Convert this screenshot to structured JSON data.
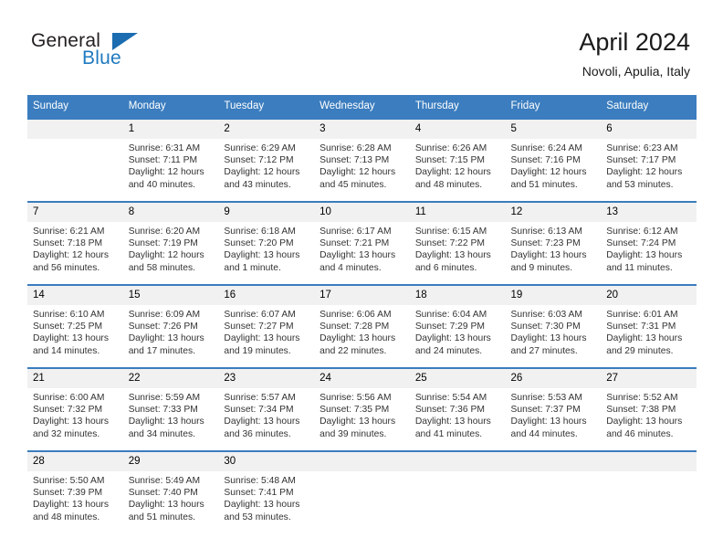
{
  "brand": {
    "name_top": "General",
    "name_bottom": "Blue",
    "accent_color": "#1b6cb0"
  },
  "header": {
    "title": "April 2024",
    "subtitle": "Novoli, Apulia, Italy"
  },
  "theme": {
    "header_blue": "#3b7dbf",
    "daynum_bg": "#f1f1f1"
  },
  "calendar": {
    "weekday_headers": [
      "Sunday",
      "Monday",
      "Tuesday",
      "Wednesday",
      "Thursday",
      "Friday",
      "Saturday"
    ],
    "labels": {
      "sunrise": "Sunrise:",
      "sunset": "Sunset:",
      "daylight": "Daylight:"
    },
    "weeks": [
      [
        {
          "day": "",
          "empty": true,
          "sunrise": "",
          "sunset": "",
          "daylight_line1": "",
          "daylight_line2": ""
        },
        {
          "day": "1",
          "sunrise": "Sunrise: 6:31 AM",
          "sunset": "Sunset: 7:11 PM",
          "daylight_line1": "Daylight: 12 hours",
          "daylight_line2": "and 40 minutes."
        },
        {
          "day": "2",
          "sunrise": "Sunrise: 6:29 AM",
          "sunset": "Sunset: 7:12 PM",
          "daylight_line1": "Daylight: 12 hours",
          "daylight_line2": "and 43 minutes."
        },
        {
          "day": "3",
          "sunrise": "Sunrise: 6:28 AM",
          "sunset": "Sunset: 7:13 PM",
          "daylight_line1": "Daylight: 12 hours",
          "daylight_line2": "and 45 minutes."
        },
        {
          "day": "4",
          "sunrise": "Sunrise: 6:26 AM",
          "sunset": "Sunset: 7:15 PM",
          "daylight_line1": "Daylight: 12 hours",
          "daylight_line2": "and 48 minutes."
        },
        {
          "day": "5",
          "sunrise": "Sunrise: 6:24 AM",
          "sunset": "Sunset: 7:16 PM",
          "daylight_line1": "Daylight: 12 hours",
          "daylight_line2": "and 51 minutes."
        },
        {
          "day": "6",
          "sunrise": "Sunrise: 6:23 AM",
          "sunset": "Sunset: 7:17 PM",
          "daylight_line1": "Daylight: 12 hours",
          "daylight_line2": "and 53 minutes."
        }
      ],
      [
        {
          "day": "7",
          "sunrise": "Sunrise: 6:21 AM",
          "sunset": "Sunset: 7:18 PM",
          "daylight_line1": "Daylight: 12 hours",
          "daylight_line2": "and 56 minutes."
        },
        {
          "day": "8",
          "sunrise": "Sunrise: 6:20 AM",
          "sunset": "Sunset: 7:19 PM",
          "daylight_line1": "Daylight: 12 hours",
          "daylight_line2": "and 58 minutes."
        },
        {
          "day": "9",
          "sunrise": "Sunrise: 6:18 AM",
          "sunset": "Sunset: 7:20 PM",
          "daylight_line1": "Daylight: 13 hours",
          "daylight_line2": "and 1 minute."
        },
        {
          "day": "10",
          "sunrise": "Sunrise: 6:17 AM",
          "sunset": "Sunset: 7:21 PM",
          "daylight_line1": "Daylight: 13 hours",
          "daylight_line2": "and 4 minutes."
        },
        {
          "day": "11",
          "sunrise": "Sunrise: 6:15 AM",
          "sunset": "Sunset: 7:22 PM",
          "daylight_line1": "Daylight: 13 hours",
          "daylight_line2": "and 6 minutes."
        },
        {
          "day": "12",
          "sunrise": "Sunrise: 6:13 AM",
          "sunset": "Sunset: 7:23 PM",
          "daylight_line1": "Daylight: 13 hours",
          "daylight_line2": "and 9 minutes."
        },
        {
          "day": "13",
          "sunrise": "Sunrise: 6:12 AM",
          "sunset": "Sunset: 7:24 PM",
          "daylight_line1": "Daylight: 13 hours",
          "daylight_line2": "and 11 minutes."
        }
      ],
      [
        {
          "day": "14",
          "sunrise": "Sunrise: 6:10 AM",
          "sunset": "Sunset: 7:25 PM",
          "daylight_line1": "Daylight: 13 hours",
          "daylight_line2": "and 14 minutes."
        },
        {
          "day": "15",
          "sunrise": "Sunrise: 6:09 AM",
          "sunset": "Sunset: 7:26 PM",
          "daylight_line1": "Daylight: 13 hours",
          "daylight_line2": "and 17 minutes."
        },
        {
          "day": "16",
          "sunrise": "Sunrise: 6:07 AM",
          "sunset": "Sunset: 7:27 PM",
          "daylight_line1": "Daylight: 13 hours",
          "daylight_line2": "and 19 minutes."
        },
        {
          "day": "17",
          "sunrise": "Sunrise: 6:06 AM",
          "sunset": "Sunset: 7:28 PM",
          "daylight_line1": "Daylight: 13 hours",
          "daylight_line2": "and 22 minutes."
        },
        {
          "day": "18",
          "sunrise": "Sunrise: 6:04 AM",
          "sunset": "Sunset: 7:29 PM",
          "daylight_line1": "Daylight: 13 hours",
          "daylight_line2": "and 24 minutes."
        },
        {
          "day": "19",
          "sunrise": "Sunrise: 6:03 AM",
          "sunset": "Sunset: 7:30 PM",
          "daylight_line1": "Daylight: 13 hours",
          "daylight_line2": "and 27 minutes."
        },
        {
          "day": "20",
          "sunrise": "Sunrise: 6:01 AM",
          "sunset": "Sunset: 7:31 PM",
          "daylight_line1": "Daylight: 13 hours",
          "daylight_line2": "and 29 minutes."
        }
      ],
      [
        {
          "day": "21",
          "sunrise": "Sunrise: 6:00 AM",
          "sunset": "Sunset: 7:32 PM",
          "daylight_line1": "Daylight: 13 hours",
          "daylight_line2": "and 32 minutes."
        },
        {
          "day": "22",
          "sunrise": "Sunrise: 5:59 AM",
          "sunset": "Sunset: 7:33 PM",
          "daylight_line1": "Daylight: 13 hours",
          "daylight_line2": "and 34 minutes."
        },
        {
          "day": "23",
          "sunrise": "Sunrise: 5:57 AM",
          "sunset": "Sunset: 7:34 PM",
          "daylight_line1": "Daylight: 13 hours",
          "daylight_line2": "and 36 minutes."
        },
        {
          "day": "24",
          "sunrise": "Sunrise: 5:56 AM",
          "sunset": "Sunset: 7:35 PM",
          "daylight_line1": "Daylight: 13 hours",
          "daylight_line2": "and 39 minutes."
        },
        {
          "day": "25",
          "sunrise": "Sunrise: 5:54 AM",
          "sunset": "Sunset: 7:36 PM",
          "daylight_line1": "Daylight: 13 hours",
          "daylight_line2": "and 41 minutes."
        },
        {
          "day": "26",
          "sunrise": "Sunrise: 5:53 AM",
          "sunset": "Sunset: 7:37 PM",
          "daylight_line1": "Daylight: 13 hours",
          "daylight_line2": "and 44 minutes."
        },
        {
          "day": "27",
          "sunrise": "Sunrise: 5:52 AM",
          "sunset": "Sunset: 7:38 PM",
          "daylight_line1": "Daylight: 13 hours",
          "daylight_line2": "and 46 minutes."
        }
      ],
      [
        {
          "day": "28",
          "sunrise": "Sunrise: 5:50 AM",
          "sunset": "Sunset: 7:39 PM",
          "daylight_line1": "Daylight: 13 hours",
          "daylight_line2": "and 48 minutes."
        },
        {
          "day": "29",
          "sunrise": "Sunrise: 5:49 AM",
          "sunset": "Sunset: 7:40 PM",
          "daylight_line1": "Daylight: 13 hours",
          "daylight_line2": "and 51 minutes."
        },
        {
          "day": "30",
          "sunrise": "Sunrise: 5:48 AM",
          "sunset": "Sunset: 7:41 PM",
          "daylight_line1": "Daylight: 13 hours",
          "daylight_line2": "and 53 minutes."
        },
        {
          "day": "",
          "empty": true,
          "sunrise": "",
          "sunset": "",
          "daylight_line1": "",
          "daylight_line2": ""
        },
        {
          "day": "",
          "empty": true,
          "sunrise": "",
          "sunset": "",
          "daylight_line1": "",
          "daylight_line2": ""
        },
        {
          "day": "",
          "empty": true,
          "sunrise": "",
          "sunset": "",
          "daylight_line1": "",
          "daylight_line2": ""
        },
        {
          "day": "",
          "empty": true,
          "sunrise": "",
          "sunset": "",
          "daylight_line1": "",
          "daylight_line2": ""
        }
      ]
    ]
  }
}
